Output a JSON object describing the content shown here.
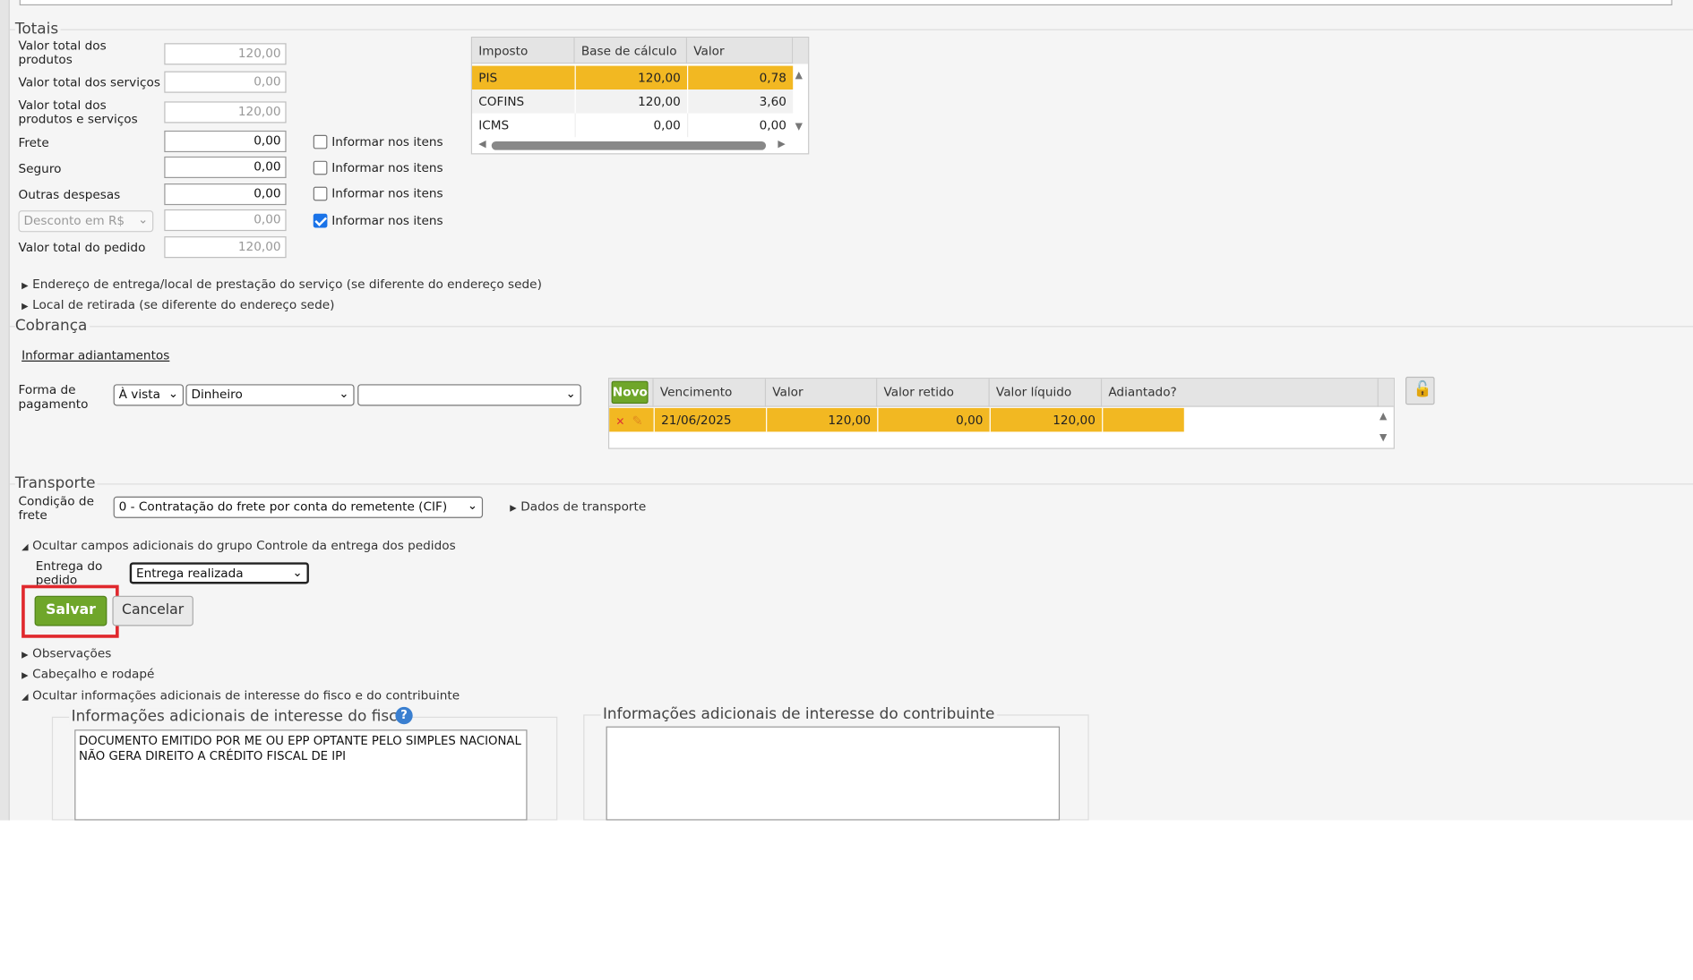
{
  "totais": {
    "title": "Totais",
    "rows": [
      {
        "label": "Valor total dos produtos",
        "value": "120,00"
      },
      {
        "label": "Valor total dos serviços",
        "value": "0,00"
      },
      {
        "label": "Valor total dos produtos e serviços",
        "value": "120,00"
      },
      {
        "label": "Frete",
        "value": "0,00",
        "check_label": "Informar nos itens",
        "checked": false
      },
      {
        "label": "Seguro",
        "value": "0,00",
        "check_label": "Informar nos itens",
        "checked": false
      },
      {
        "label": "Outras despesas",
        "value": "0,00",
        "check_label": "Informar nos itens",
        "checked": false
      },
      {
        "label": "Desconto em R$",
        "value": "0,00",
        "check_label": "Informar nos itens",
        "checked": true
      },
      {
        "label": "Valor total do pedido",
        "value": "120,00"
      }
    ],
    "impostos": {
      "headers": [
        "Imposto",
        "Base de cálculo",
        "Valor"
      ],
      "rows": [
        {
          "imposto": "PIS",
          "base": "120,00",
          "valor": "0,78"
        },
        {
          "imposto": "COFINS",
          "base": "120,00",
          "valor": "3,60"
        },
        {
          "imposto": "ICMS",
          "base": "0,00",
          "valor": "0,00"
        }
      ]
    }
  },
  "expanders": {
    "entrega": "Endereço de entrega/local de prestação do serviço (se diferente do endereço sede)",
    "retirada": "Local de retirada (se diferente do endereço sede)",
    "controle": "Ocultar campos adicionais do grupo Controle da entrega dos pedidos",
    "observacoes": "Observações",
    "cabecalho": "Cabeçalho e rodapé",
    "infos": "Ocultar informações adicionais de interesse do fisco e do contribuinte",
    "dados_transporte": "Dados de transporte"
  },
  "cobranca": {
    "title": "Cobrança",
    "adiantamentos_link": "Informar adiantamentos",
    "forma_label": "Forma de pagamento",
    "forma": "À vista",
    "meio": "Dinheiro",
    "extra": "",
    "novo": "Novo",
    "headers": [
      "Vencimento",
      "Valor",
      "Valor retido",
      "Valor líquido",
      "Adiantado?"
    ],
    "parcela": {
      "vencimento": "21/06/2025",
      "valor": "120,00",
      "retido": "0,00",
      "liquido": "120,00",
      "adiantado": ""
    }
  },
  "transporte": {
    "title": "Transporte",
    "condicao_label": "Condição de frete",
    "condicao": "0 - Contratação do frete por conta do remetente (CIF)"
  },
  "controle": {
    "entrega_label": "Entrega do pedido",
    "entrega": "Entrega realizada"
  },
  "actions": {
    "save": "Salvar",
    "cancel": "Cancelar"
  },
  "infos": {
    "fisco_title": "Informações adicionais de interesse do fisco",
    "fisco_text": "DOCUMENTO EMITIDO POR ME OU EPP OPTANTE PELO SIMPLES NACIONAL NÃO GERA DIREITO A CRÉDITO FISCAL DE IPI",
    "contribuinte_title": "Informações adicionais de interesse do contribuinte",
    "contribuinte_text": ""
  },
  "colors": {
    "accent_yellow": "#f2b822",
    "save_green": "#6fa62a",
    "highlight_red": "#e0282d"
  }
}
